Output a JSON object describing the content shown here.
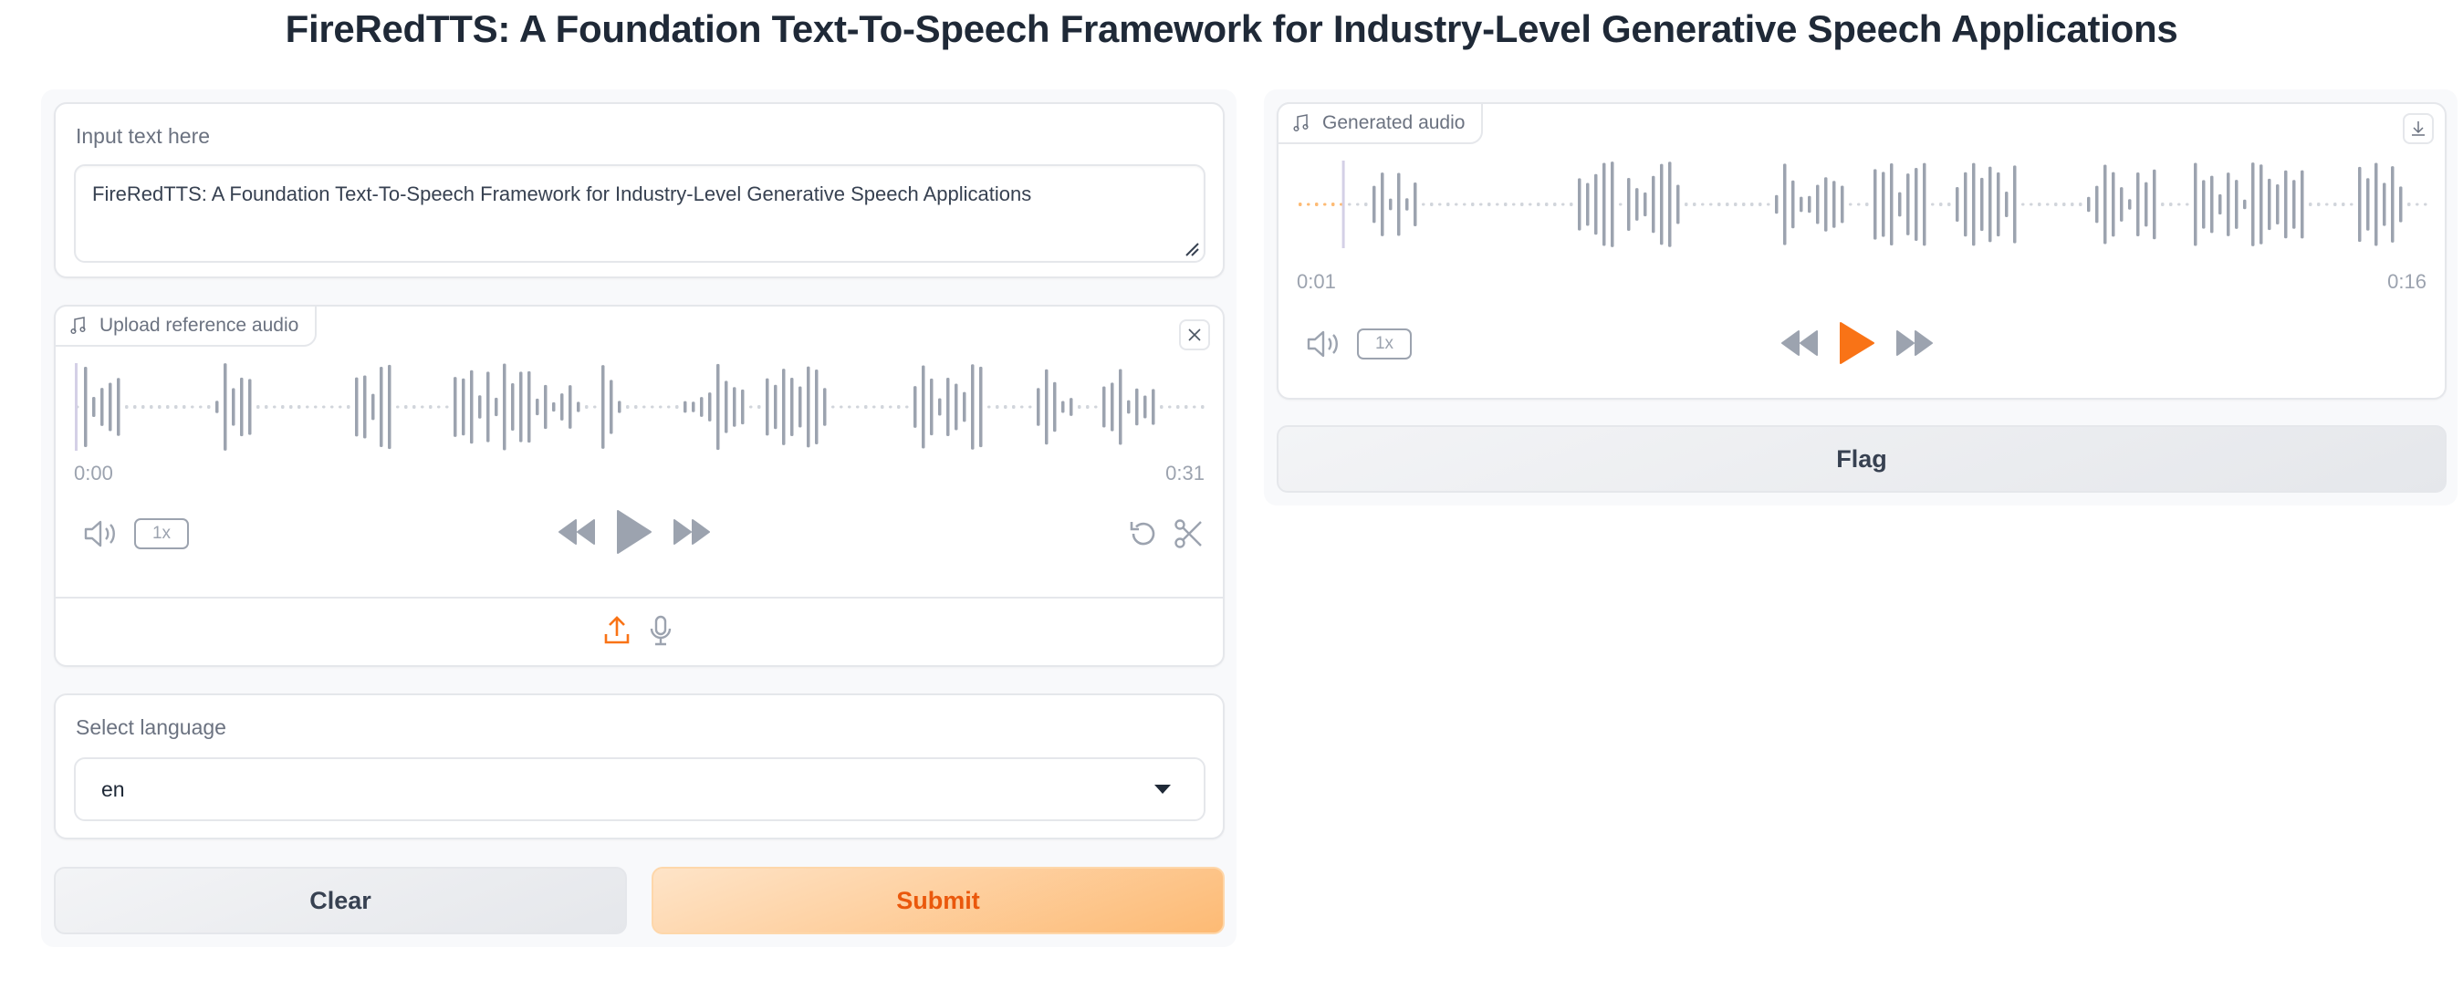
{
  "page": {
    "title": "FireRedTTS: A Foundation Text-To-Speech Framework for Industry-Level Generative Speech Applications"
  },
  "inputs": {
    "text": {
      "label": "Input text here",
      "value": "FireRedTTS: A Foundation Text-To-Speech Framework for Industry-Level Generative Speech Applications"
    },
    "reference_audio": {
      "label": "Upload reference audio",
      "time_current": "0:00",
      "time_total": "0:31",
      "playback_speed": "1x",
      "progress": 0.0,
      "icons": {
        "label": "music-note-icon",
        "clear": "close-icon",
        "volume": "volume-icon",
        "rewind": "rewind-icon",
        "play": "play-icon",
        "forward": "fast-forward-icon",
        "undo": "undo-icon",
        "trim": "scissors-icon",
        "upload": "upload-icon",
        "record": "microphone-icon"
      }
    },
    "language": {
      "label": "Select language",
      "selected": "en"
    },
    "buttons": {
      "clear": "Clear",
      "submit": "Submit"
    }
  },
  "outputs": {
    "generated_audio": {
      "label": "Generated audio",
      "time_current": "0:01",
      "time_total": "0:16",
      "playback_speed": "1x",
      "progress": 0.04,
      "icons": {
        "label": "music-note-icon",
        "download": "download-icon",
        "volume": "volume-icon",
        "rewind": "rewind-icon",
        "play": "play-icon",
        "forward": "fast-forward-icon"
      }
    },
    "buttons": {
      "flag": "Flag"
    }
  },
  "colors": {
    "accent": "#f97316",
    "accent_light": "#fdba74",
    "wave_gray": "#9ca3af",
    "cursor": "#d4d0e6"
  }
}
